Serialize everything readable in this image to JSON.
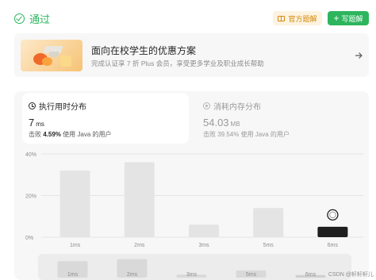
{
  "header": {
    "status_label": "通过",
    "status_icon": "check-circle-icon",
    "official_solution_label": "官方题解",
    "write_solution_label": "写题解",
    "accent_green": "#2db55d",
    "accent_orange": "#d48806"
  },
  "banner": {
    "title": "面向在校学生的优惠方案",
    "subtitle": "完成认证享 7 折 Plus 会员，享受更多学业及职业成长帮助",
    "arrow_icon": "arrow-right-icon"
  },
  "runtime": {
    "title": "执行用时分布",
    "value": "7",
    "unit": "ms",
    "beats_prefix": "击败",
    "beats_value": "4.59%",
    "beats_suffix": "使用 Java 的用户"
  },
  "memory": {
    "title": "消耗内存分布",
    "value": "54.03",
    "unit": "MB",
    "beats_text": "击败 39.54% 使用 Java 的用户"
  },
  "chart_data": {
    "type": "bar",
    "categories": [
      "1ms",
      "2ms",
      "3ms",
      "5ms",
      "6ms"
    ],
    "values": [
      32,
      36,
      6,
      14,
      5
    ],
    "highlight_index": 4,
    "y_ticks": [
      "40%",
      "20%",
      "0%"
    ],
    "ylim": [
      0,
      40
    ],
    "grid": true,
    "bar_color": "#e4e4e4",
    "highlight_color": "#1f1f1f"
  },
  "overview": {
    "categories": [
      "1ms",
      "2ms",
      "3ms",
      "5ms",
      "6ms"
    ]
  },
  "watermark": "CSDN @轩轩轩儿"
}
